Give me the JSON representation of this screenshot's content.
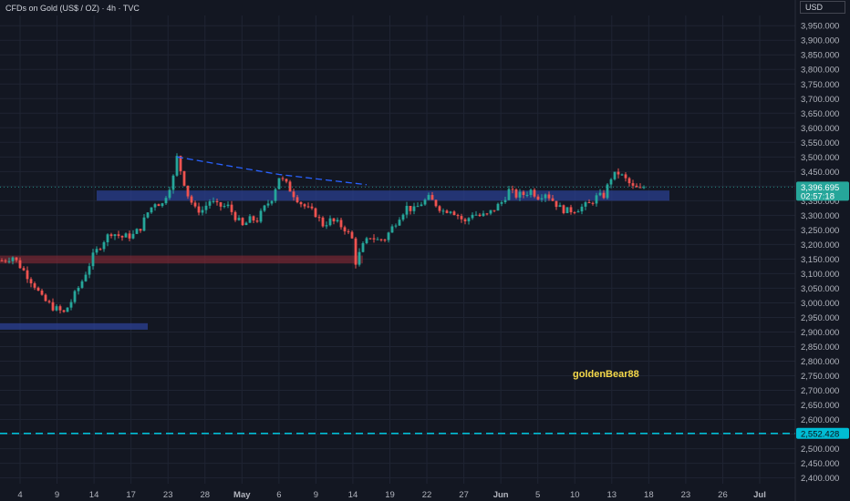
{
  "header": {
    "title": "CFDs on Gold (US$ / OZ) · 4h · TVC",
    "unit_label": "USD"
  },
  "watermark": {
    "text": "goldenBear88"
  },
  "colors": {
    "background": "#131722",
    "grid": "#1f2433",
    "up_candle": "#26a69a",
    "down_candle": "#ef5350",
    "support_zone": "#2a3f8f",
    "resistance_zone": "#8b2a35",
    "trendline": "#2962ff",
    "target_line": "#00bcd4",
    "watermark": "#f5d94a"
  },
  "chart_data": {
    "type": "candlestick",
    "price_axis": {
      "labels": [
        "3,950.000",
        "3,900.000",
        "3,850.000",
        "3,800.000",
        "3,750.000",
        "3,700.000",
        "3,650.000",
        "3,600.000",
        "3,550.000",
        "3,500.000",
        "3,450.000",
        "3,400.000",
        "3,350.000",
        "3,300.000",
        "3,250.000",
        "3,200.000",
        "3,150.000",
        "3,100.000",
        "3,050.000",
        "3,000.000",
        "2,950.000",
        "2,900.000",
        "2,850.000",
        "2,800.000",
        "2,750.000",
        "2,700.000",
        "2,650.000",
        "2,600.000",
        "2,550.000",
        "2,500.000",
        "2,450.000",
        "2,400.000"
      ],
      "ylim": [
        2380,
        3985
      ]
    },
    "time_axis": {
      "labels": [
        "4",
        "9",
        "14",
        "17",
        "23",
        "28",
        "May",
        "6",
        "9",
        "14",
        "19",
        "22",
        "27",
        "Jun",
        "5",
        "10",
        "13",
        "18",
        "23",
        "26",
        "Jul"
      ],
      "major": [
        "May",
        "Jun",
        "Jul"
      ]
    },
    "price_path": [
      [
        0,
        3145
      ],
      [
        3,
        3158
      ],
      [
        6,
        3110
      ],
      [
        9,
        3060
      ],
      [
        11,
        3015
      ],
      [
        14,
        2985
      ],
      [
        17,
        2965
      ],
      [
        19,
        3005
      ],
      [
        22,
        3075
      ],
      [
        25,
        3160
      ],
      [
        28,
        3215
      ],
      [
        30,
        3242
      ],
      [
        33,
        3225
      ],
      [
        36,
        3232
      ],
      [
        38,
        3258
      ],
      [
        40,
        3310
      ],
      [
        42,
        3345
      ],
      [
        44,
        3338
      ],
      [
        45,
        3370
      ],
      [
        47,
        3430
      ],
      [
        48,
        3498
      ],
      [
        49,
        3455
      ],
      [
        51,
        3370
      ],
      [
        53,
        3320
      ],
      [
        55,
        3318
      ],
      [
        57,
        3350
      ],
      [
        59,
        3332
      ],
      [
        62,
        3330
      ],
      [
        64,
        3295
      ],
      [
        66,
        3262
      ],
      [
        68,
        3285
      ],
      [
        70,
        3285
      ],
      [
        72,
        3325
      ],
      [
        74,
        3360
      ],
      [
        76,
        3432
      ],
      [
        78,
        3405
      ],
      [
        80,
        3372
      ],
      [
        82,
        3342
      ],
      [
        84,
        3320
      ],
      [
        86,
        3305
      ],
      [
        88,
        3268
      ],
      [
        90,
        3282
      ],
      [
        92,
        3272
      ],
      [
        94,
        3255
      ],
      [
        96,
        3218
      ],
      [
        97,
        3140
      ],
      [
        99,
        3195
      ],
      [
        101,
        3228
      ],
      [
        103,
        3215
      ],
      [
        105,
        3220
      ],
      [
        107,
        3258
      ],
      [
        109,
        3298
      ],
      [
        111,
        3328
      ],
      [
        113,
        3318
      ],
      [
        115,
        3342
      ],
      [
        117,
        3358
      ],
      [
        119,
        3338
      ],
      [
        121,
        3315
      ],
      [
        123,
        3322
      ],
      [
        125,
        3300
      ],
      [
        127,
        3275
      ],
      [
        129,
        3308
      ],
      [
        131,
        3298
      ],
      [
        133,
        3300
      ],
      [
        135,
        3322
      ],
      [
        137,
        3345
      ],
      [
        139,
        3385
      ],
      [
        141,
        3368
      ],
      [
        143,
        3372
      ],
      [
        145,
        3385
      ],
      [
        147,
        3365
      ],
      [
        149,
        3378
      ],
      [
        151,
        3352
      ],
      [
        153,
        3325
      ],
      [
        155,
        3315
      ],
      [
        157,
        3320
      ],
      [
        159,
        3328
      ],
      [
        161,
        3338
      ],
      [
        163,
        3362
      ],
      [
        165,
        3368
      ],
      [
        166,
        3398
      ],
      [
        167,
        3430
      ],
      [
        169,
        3445
      ],
      [
        171,
        3422
      ],
      [
        173,
        3395
      ],
      [
        175,
        3388
      ],
      [
        176,
        3396.695
      ]
    ],
    "last_price": "3,396.695",
    "countdown": "02:57:18",
    "target_level": "2,552.428",
    "target_value": 2552.428,
    "support_zone": {
      "low": 3350,
      "high": 3385
    },
    "resistance_zone": {
      "low": 3135,
      "high": 3162
    },
    "lower_zone": {
      "low": 2908,
      "high": 2930
    },
    "trendline": [
      {
        "price": 3500
      },
      {
        "price": 3440
      },
      {
        "price": 3405
      }
    ]
  }
}
